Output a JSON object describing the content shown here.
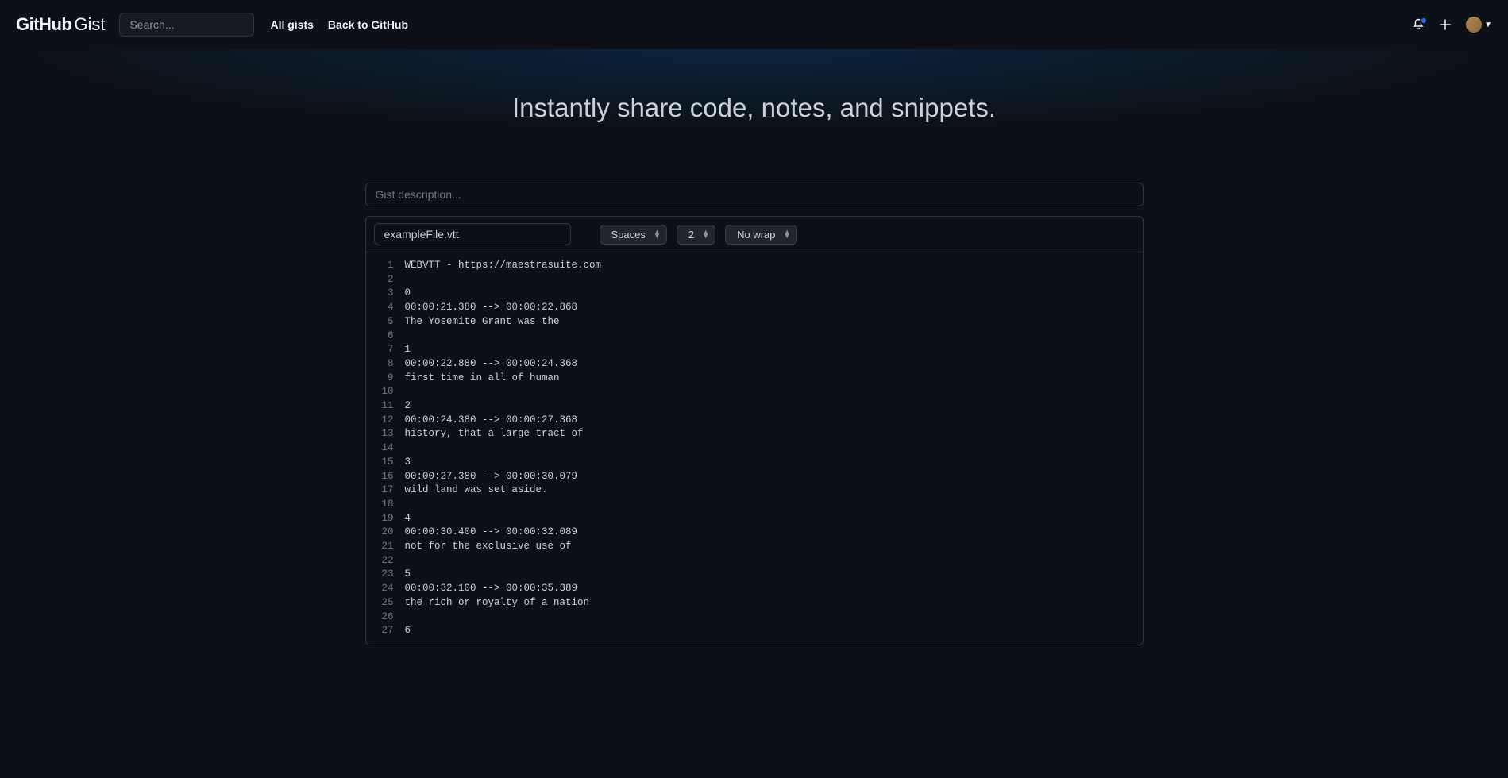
{
  "header": {
    "logo_primary": "GitHub",
    "logo_secondary": "Gist",
    "search_placeholder": "Search...",
    "nav": {
      "all_gists": "All gists",
      "back": "Back to GitHub"
    }
  },
  "hero": {
    "tagline": "Instantly share code, notes, and snippets."
  },
  "form": {
    "description_placeholder": "Gist description...",
    "filename": "exampleFile.vtt",
    "indent_mode": "Spaces",
    "indent_size": "2",
    "wrap_mode": "No wrap"
  },
  "code": {
    "lines": [
      "WEBVTT - https://maestrasuite.com",
      "",
      "0",
      "00:00:21.380 --> 00:00:22.868",
      "The Yosemite Grant was the",
      "",
      "1",
      "00:00:22.880 --> 00:00:24.368",
      "first time in all of human",
      "",
      "2",
      "00:00:24.380 --> 00:00:27.368",
      "history, that a large tract of",
      "",
      "3",
      "00:00:27.380 --> 00:00:30.079",
      "wild land was set aside.",
      "",
      "4",
      "00:00:30.400 --> 00:00:32.089",
      "not for the exclusive use of",
      "",
      "5",
      "00:00:32.100 --> 00:00:35.389",
      "the rich or royalty of a nation",
      "",
      "6"
    ]
  }
}
